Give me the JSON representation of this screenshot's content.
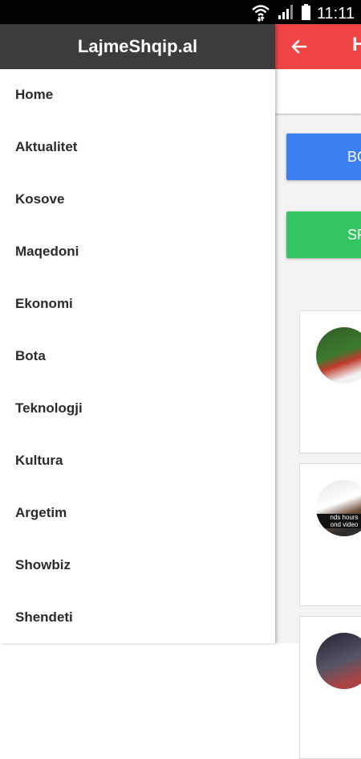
{
  "status_bar": {
    "time": "11:11",
    "icons": [
      "wifi-data-icon",
      "signal-icon",
      "battery-icon"
    ]
  },
  "drawer": {
    "title": "LajmeShqip.al",
    "items": [
      {
        "label": "Home"
      },
      {
        "label": "Aktualitet"
      },
      {
        "label": "Kosove"
      },
      {
        "label": "Maqedoni"
      },
      {
        "label": "Ekonomi"
      },
      {
        "label": "Bota"
      },
      {
        "label": "Teknologji"
      },
      {
        "label": "Kultura"
      },
      {
        "label": "Argetim"
      },
      {
        "label": "Showbiz"
      },
      {
        "label": "Shendeti"
      }
    ]
  },
  "background_page": {
    "appbar_title_visible": "H",
    "buttons": [
      {
        "label": "BO",
        "color": "#3b7ff0"
      },
      {
        "label": "SP",
        "color": "#34c563"
      }
    ],
    "card_captions": [
      "",
      "nds hours\nond video",
      ""
    ]
  },
  "colors": {
    "drawer_header": "#3c3c3c",
    "appbar": "#ef4444"
  }
}
